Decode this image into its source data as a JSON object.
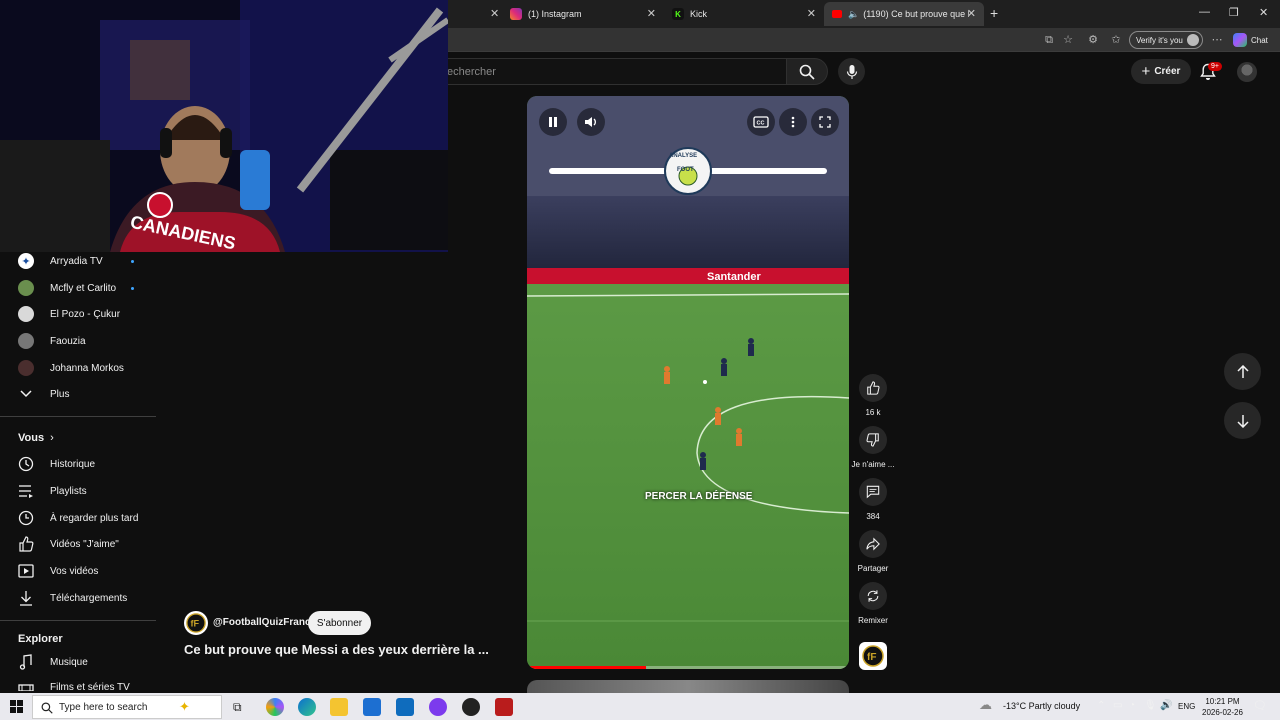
{
  "browser": {
    "tabs": [
      {
        "label": "(1) Instagram",
        "icon": "instagram-icon"
      },
      {
        "label": "Kick",
        "icon": "kick-icon"
      },
      {
        "label": "(1190) Ce but prouve que Me",
        "icon": "youtube-icon",
        "active": true
      }
    ],
    "new_tab": "+",
    "verify_label": "Verify it's you",
    "chat_label": "Chat"
  },
  "header": {
    "search_placeholder": "echercher",
    "create_label": "Créer",
    "notifications_badge": "9+"
  },
  "sidebar": {
    "subscriptions": [
      {
        "label": "Arryadia TV",
        "new": true,
        "color": "#ffffff"
      },
      {
        "label": "Mcfly et Carlito",
        "new": true,
        "color": "#6a8f4e"
      },
      {
        "label": "El Pozo - Çukur",
        "new": false,
        "color": "#d9d9d9"
      },
      {
        "label": "Faouzia",
        "new": false,
        "color": "#777777"
      },
      {
        "label": "Johanna Morkos",
        "new": false,
        "color": "#4a2e2e"
      }
    ],
    "more_label": "Plus",
    "you_heading": "Vous",
    "you_items": [
      {
        "label": "Historique",
        "icon": "history-icon"
      },
      {
        "label": "Playlists",
        "icon": "playlists-icon"
      },
      {
        "label": "À regarder plus tard",
        "icon": "watch-later-icon"
      },
      {
        "label": "Vidéos \"J'aime\"",
        "icon": "like-icon"
      },
      {
        "label": "Vos vidéos",
        "icon": "your-videos-icon"
      },
      {
        "label": "Téléchargements",
        "icon": "download-icon"
      }
    ],
    "explore_heading": "Explorer",
    "explore_items": [
      {
        "label": "Musique",
        "icon": "music-icon"
      },
      {
        "label": "Films et séries TV",
        "icon": "films-icon"
      }
    ]
  },
  "video": {
    "overlay_text": "PERCER LA DÉFENSE",
    "logo_text_top": "ANALYSE",
    "logo_text_bottom": "FOOT",
    "sponsor": "Santander",
    "progress": 0.37
  },
  "actions": {
    "likes": "16 k",
    "dislike_label": "Je n'aime ...",
    "comments": "384",
    "share_label": "Partager",
    "remix_label": "Remixer"
  },
  "channel": {
    "handle": "@FootballQuizFrance",
    "subscribe_label": "S'abonner",
    "title": "Ce but prouve que Messi a des yeux derrière la ..."
  },
  "taskbar": {
    "search_placeholder": "Type here to search",
    "weather": "-13°C  Partly cloudy",
    "language": "ENG",
    "time": "10:21 PM",
    "date": "2026-02-26"
  },
  "colors": {
    "youtube_red": "#ff0000",
    "link_blue": "#3ea6ff",
    "pitch_green": "#4e8d3a"
  }
}
